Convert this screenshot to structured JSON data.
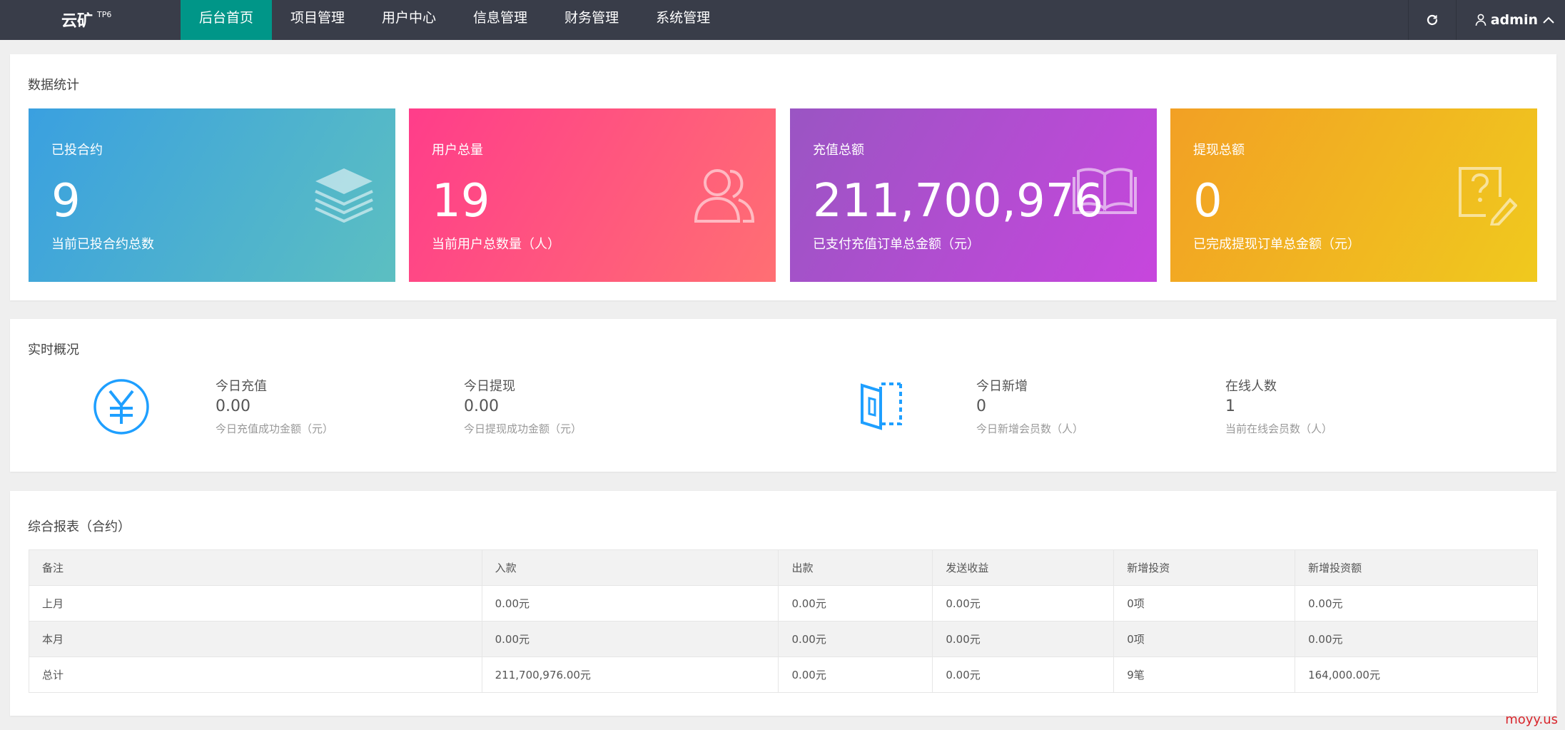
{
  "app": {
    "logo": "云矿",
    "logo_badge": "TP6"
  },
  "nav": {
    "items": [
      {
        "label": "后台首页",
        "active": true
      },
      {
        "label": "项目管理"
      },
      {
        "label": "用户中心"
      },
      {
        "label": "信息管理"
      },
      {
        "label": "财务管理"
      },
      {
        "label": "系统管理"
      }
    ],
    "user": "admin",
    "refresh_icon": "refresh-icon",
    "user_icon": "user-icon"
  },
  "stats": {
    "title": "数据统计",
    "tiles": [
      {
        "label": "已投合约",
        "value": "9",
        "desc": "当前已投合约总数",
        "icon": "layers-icon",
        "colors": [
          "#3aa0e0",
          "#5cbfc1"
        ]
      },
      {
        "label": "用户总量",
        "value": "19",
        "desc": "当前用户总数量（人）",
        "icon": "users-icon",
        "colors": [
          "#ff3d8a",
          "#ff6f73"
        ]
      },
      {
        "label": "充值总额",
        "value": "211,700,976",
        "desc": "已支付充值订单总金额（元）",
        "icon": "book-icon",
        "colors": [
          "#9a55c3",
          "#c746dd"
        ]
      },
      {
        "label": "提现总额",
        "value": "0",
        "desc": "已完成提现订单总金额（元）",
        "icon": "edit-doc-icon",
        "colors": [
          "#f2a024",
          "#f0c91e"
        ]
      }
    ]
  },
  "realtime": {
    "title": "实时概况",
    "items": [
      {
        "label": "今日充值",
        "value": "0.00",
        "desc": "今日充值成功金额（元）"
      },
      {
        "label": "今日提现",
        "value": "0.00",
        "desc": "今日提现成功金额（元）"
      },
      {
        "label": "今日新增",
        "value": "0",
        "desc": "今日新增会员数（人）"
      },
      {
        "label": "在线人数",
        "value": "1",
        "desc": "当前在线会员数（人）"
      }
    ],
    "accent": "#1e9fff"
  },
  "report": {
    "title": "综合报表（合约）",
    "columns": [
      "备注",
      "入款",
      "出款",
      "发送收益",
      "新增投资",
      "新增投资额"
    ],
    "rows": [
      [
        "上月",
        "0.00元",
        "0.00元",
        "0.00元",
        "0项",
        "0.00元"
      ],
      [
        "本月",
        "0.00元",
        "0.00元",
        "0.00元",
        "0项",
        "0.00元"
      ],
      [
        "总计",
        "211,700,976.00元",
        "0.00元",
        "0.00元",
        "9笔",
        "164,000.00元"
      ]
    ]
  },
  "watermark": "moyy.us"
}
